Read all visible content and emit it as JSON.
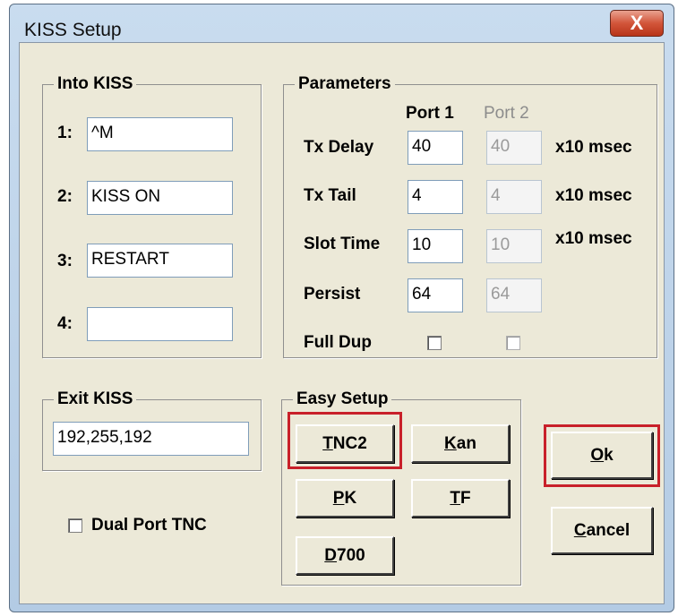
{
  "window": {
    "title": "KISS Setup",
    "close_label": "X"
  },
  "into_kiss": {
    "label": "Into KISS",
    "rows": [
      {
        "label": "1:",
        "value": "^M"
      },
      {
        "label": "2:",
        "value": "KISS ON"
      },
      {
        "label": "3:",
        "value": "RESTART"
      },
      {
        "label": "4:",
        "value": ""
      }
    ]
  },
  "parameters": {
    "label": "Parameters",
    "port1_header": "Port 1",
    "port2_header": "Port 2",
    "rows": [
      {
        "label": "Tx Delay",
        "port1": "40",
        "port2": "40",
        "unit": "x10 msec"
      },
      {
        "label": "Tx Tail",
        "port1": "4",
        "port2": "4",
        "unit": "x10 msec"
      },
      {
        "label": "Slot Time",
        "port1": "10",
        "port2": "10",
        "unit": "x10 msec"
      },
      {
        "label": "Persist",
        "port1": "64",
        "port2": "64",
        "unit": ""
      }
    ],
    "full_dup_label": "Full Dup"
  },
  "exit_kiss": {
    "label": "Exit KISS",
    "value": "192,255,192"
  },
  "dual_port_label": "Dual Port TNC",
  "easy_setup": {
    "label": "Easy Setup",
    "tnc2": {
      "hot": "T",
      "rest": "NC2"
    },
    "kan": {
      "hot": "K",
      "rest": "an"
    },
    "pk": {
      "hot": "P",
      "rest": "K"
    },
    "tf": {
      "hot": "T",
      "rest": "F"
    },
    "d700": {
      "hot": "D",
      "rest": "700"
    }
  },
  "ok": {
    "hot": "O",
    "rest": "k"
  },
  "cancel": {
    "hot": "C",
    "rest": "ancel"
  },
  "colors": {
    "highlight": "#c8202a",
    "dialog_bg": "#ece9d8",
    "title_bar": "#c9dcef"
  }
}
